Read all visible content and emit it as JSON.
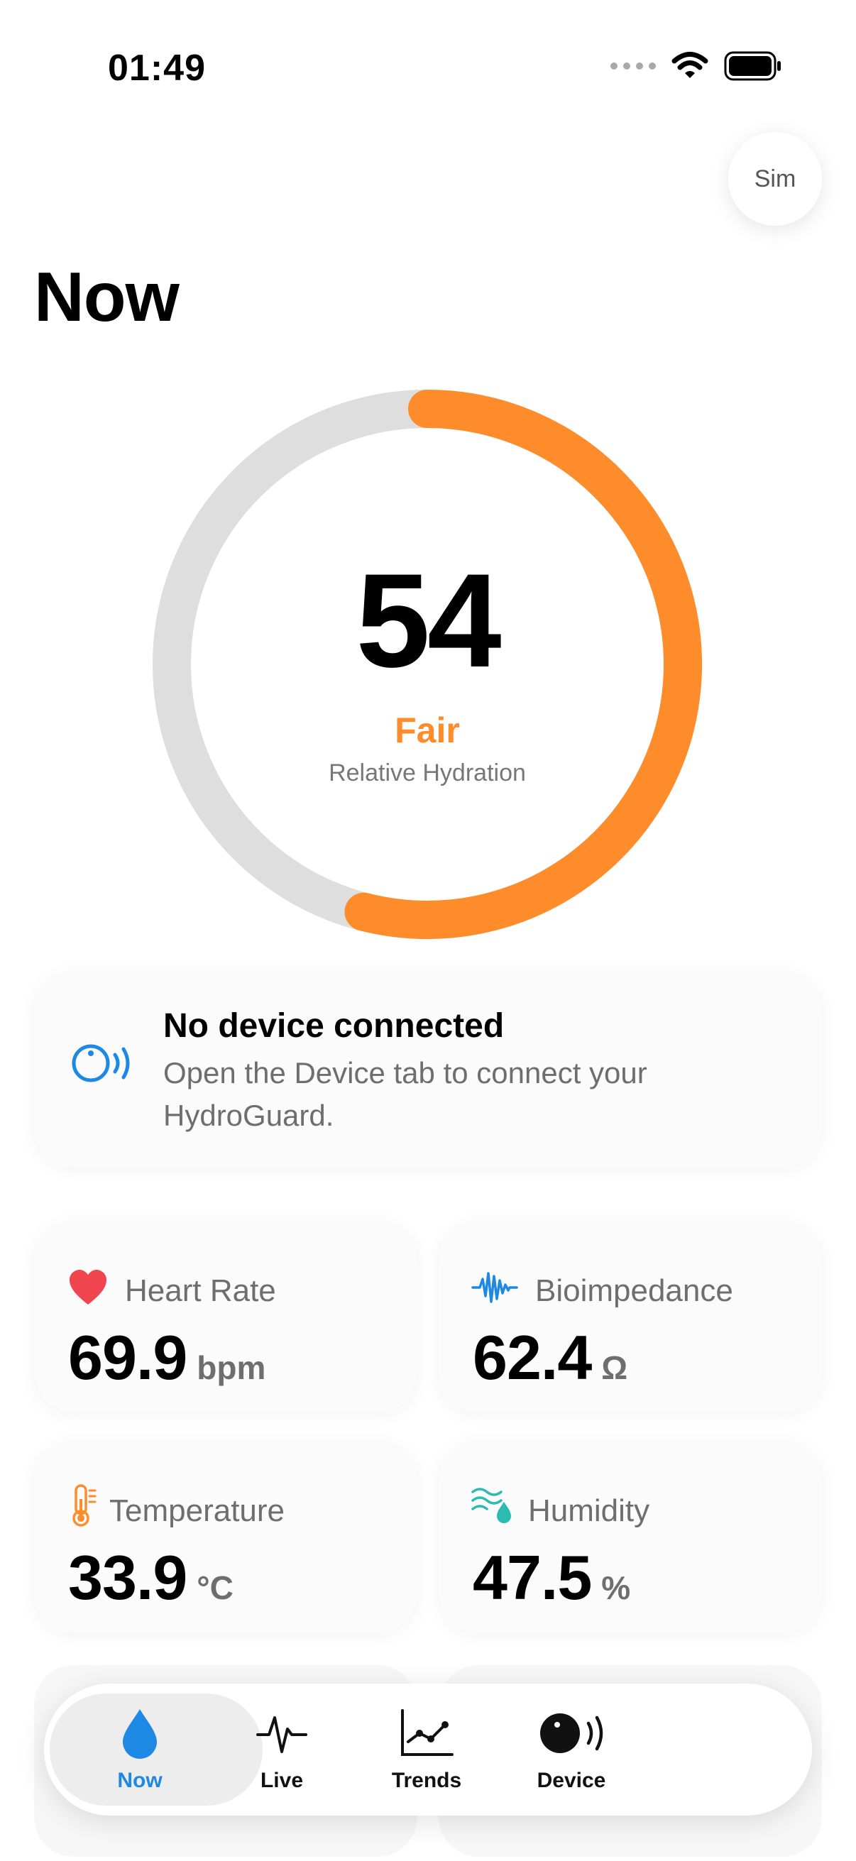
{
  "status_bar": {
    "time": "01:49"
  },
  "sim_button": {
    "label": "Sim"
  },
  "page": {
    "title": "Now"
  },
  "hydration": {
    "value": "54",
    "fraction": 0.54,
    "status": "Fair",
    "caption": "Relative Hydration",
    "colors": {
      "progress": "#ff8c2a",
      "track": "#dedede"
    }
  },
  "device_card": {
    "icon": "device-signal-icon",
    "title": "No device connected",
    "description": "Open the Device tab to connect your HydroGuard."
  },
  "metrics": [
    {
      "label": "Heart Rate",
      "value": "69.9",
      "unit": "bpm",
      "icon": "heart-icon",
      "color": "#f0444f"
    },
    {
      "label": "Bioimpedance",
      "value": "62.4",
      "unit": "Ω",
      "icon": "waveform-icon",
      "color": "#1e88e5"
    },
    {
      "label": "Temperature",
      "value": "33.9",
      "unit": "°C",
      "icon": "thermometer-icon",
      "color": "#ff8c2a"
    },
    {
      "label": "Humidity",
      "value": "47.5",
      "unit": "%",
      "icon": "humidity-icon",
      "color": "#2bbbb0"
    }
  ],
  "tab_bar": {
    "tabs": [
      {
        "label": "Now",
        "icon": "drop-icon",
        "active": true
      },
      {
        "label": "Live",
        "icon": "pulse-icon",
        "active": false
      },
      {
        "label": "Trends",
        "icon": "trend-chart-icon",
        "active": false
      },
      {
        "label": "Device",
        "icon": "device-icon",
        "active": false
      }
    ],
    "colors": {
      "active": "#1e88e5"
    }
  }
}
